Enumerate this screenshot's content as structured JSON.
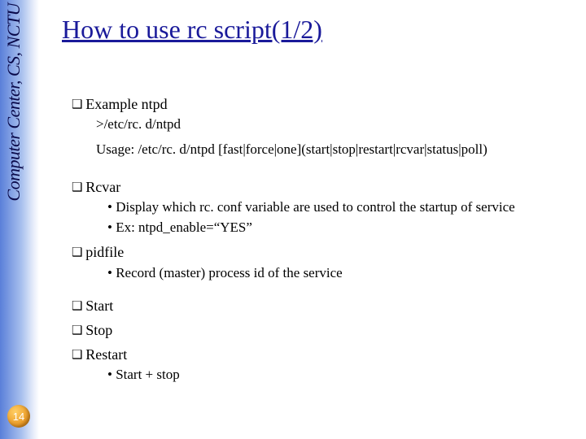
{
  "sidebar": {
    "org_text": "Computer Center, CS, NCTU"
  },
  "slide_number": "14",
  "title": "How to use rc script(1/2)",
  "items": {
    "l1_example": "Example ntpd",
    "code_line1": ">/etc/rc. d/ntpd",
    "code_line2": "Usage: /etc/rc. d/ntpd [fast|force|one](start|stop|restart|rcvar|status|poll)",
    "l1_rcvar": "Rcvar",
    "rcvar_b1": "Display which rc. conf variable are used to control the startup of service",
    "rcvar_b2": "Ex: ntpd_enable=“YES”",
    "l1_pidfile": "pidfile",
    "pidfile_b1": "Record (master) process id of the service",
    "l1_start": "Start",
    "l1_stop": "Stop",
    "l1_restart": "Restart",
    "restart_b1": "Start + stop"
  }
}
